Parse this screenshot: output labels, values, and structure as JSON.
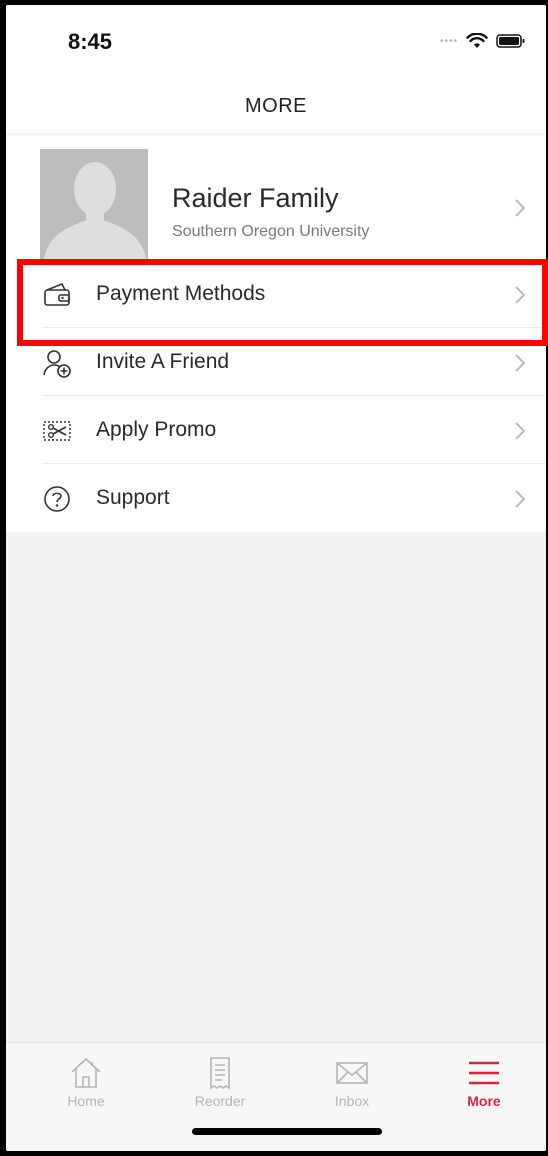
{
  "status_bar": {
    "time": "8:45"
  },
  "header": {
    "title": "MORE"
  },
  "profile": {
    "name": "Raider Family",
    "school": "Southern Oregon University"
  },
  "menu": {
    "items": [
      {
        "label": "Payment Methods",
        "icon": "wallet-icon"
      },
      {
        "label": "Invite A Friend",
        "icon": "add-user-icon"
      },
      {
        "label": "Apply Promo",
        "icon": "coupon-scissors-icon"
      },
      {
        "label": "Support",
        "icon": "help-icon"
      }
    ]
  },
  "tabs": [
    {
      "label": "Home",
      "icon": "home-icon"
    },
    {
      "label": "Reorder",
      "icon": "receipt-icon"
    },
    {
      "label": "Inbox",
      "icon": "mail-icon"
    },
    {
      "label": "More",
      "icon": "menu-icon",
      "active": true
    }
  ],
  "colors": {
    "accent": "#d7263d",
    "highlight": "#ff0000"
  }
}
